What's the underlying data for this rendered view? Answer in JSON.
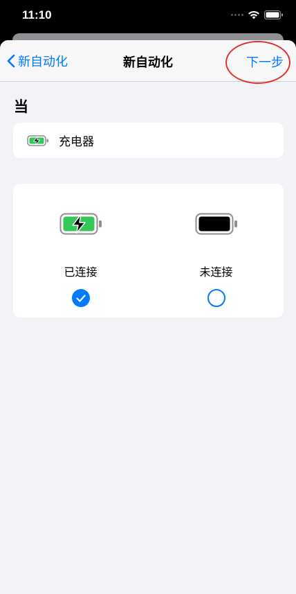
{
  "status_bar": {
    "time": "11:10"
  },
  "nav": {
    "back_label": "新自动化",
    "title": "新自动化",
    "next_label": "下一步"
  },
  "section": {
    "when_label": "当"
  },
  "trigger": {
    "label": "充电器",
    "icon": "battery-charging-icon"
  },
  "options": [
    {
      "label": "已连接",
      "icon": "battery-charging-icon",
      "selected": true
    },
    {
      "label": "未连接",
      "icon": "battery-icon",
      "selected": false
    }
  ],
  "colors": {
    "accent": "#007aff",
    "battery_green": "#34c759",
    "annotation_red": "#e03131",
    "background": "#f2f2f7"
  }
}
